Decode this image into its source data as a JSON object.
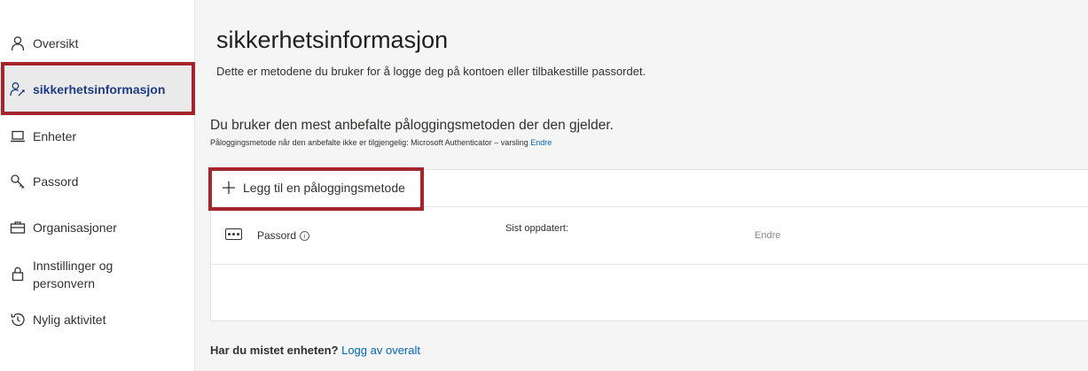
{
  "sidebar": {
    "items": [
      {
        "label": "Oversikt",
        "icon": "person-icon"
      },
      {
        "label": "sikkerhetsinformasjon",
        "icon": "key-person-icon",
        "active": true
      },
      {
        "label": "Enheter",
        "icon": "laptop-icon"
      },
      {
        "label": "Passord",
        "icon": "key-icon"
      },
      {
        "label": "Organisasjoner",
        "icon": "briefcase-icon"
      },
      {
        "label_line1": "Innstillinger og",
        "label_line2": "personvern",
        "icon": "lock-icon"
      },
      {
        "label": "Nylig aktivitet",
        "icon": "history-icon"
      }
    ]
  },
  "main": {
    "title": "sikkerhetsinformasjon",
    "description": "Dette er metodene du bruker for å logge deg på kontoen eller tilbakestille passordet.",
    "recommended_text": "Du bruker den mest anbefalte påloggingsmetoden der den gjelder.",
    "sub_text": "Påloggingsmetode når den anbefalte ikke er tilgjengelig: Microsoft Authenticator – varsling",
    "sub_link": "Endre",
    "add_method_label": "Legg til en påloggingsmetode",
    "methods": [
      {
        "name": "Passord",
        "last_updated_label": "Sist oppdatert:",
        "action": "Endre"
      }
    ],
    "lost_device_question": "Har du mistet enheten?",
    "lost_device_link": "Logg av overalt"
  },
  "colors": {
    "accent": "#0067b8",
    "highlight": "#a4262c",
    "active_text": "#1f3c88"
  }
}
